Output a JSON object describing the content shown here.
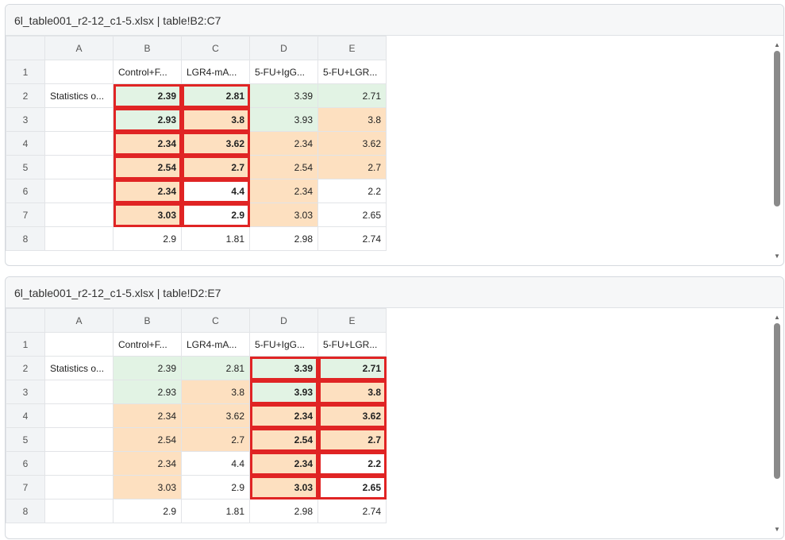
{
  "panels": [
    {
      "title": "6l_table001_r2-12_c1-5.xlsx | table!B2:C7",
      "columns": [
        "A",
        "B",
        "C",
        "D",
        "E"
      ],
      "rows": [
        {
          "num": "1",
          "cells": [
            "",
            "Control+F...",
            "LGR4-mA...",
            "5-FU+IgG...",
            "5-FU+LGR..."
          ]
        },
        {
          "num": "2",
          "cells": [
            "Statistics o...",
            "2.39",
            "2.81",
            "3.39",
            "2.71"
          ]
        },
        {
          "num": "3",
          "cells": [
            "",
            "2.93",
            "3.8",
            "3.93",
            "3.8"
          ]
        },
        {
          "num": "4",
          "cells": [
            "",
            "2.34",
            "3.62",
            "2.34",
            "3.62"
          ]
        },
        {
          "num": "5",
          "cells": [
            "",
            "2.54",
            "2.7",
            "2.54",
            "2.7"
          ]
        },
        {
          "num": "6",
          "cells": [
            "",
            "2.34",
            "4.4",
            "2.34",
            "2.2"
          ]
        },
        {
          "num": "7",
          "cells": [
            "",
            "3.03",
            "2.9",
            "3.03",
            "2.65"
          ]
        },
        {
          "num": "8",
          "cells": [
            "",
            "2.9",
            "1.81",
            "2.98",
            "2.74"
          ]
        }
      ]
    },
    {
      "title": "6l_table001_r2-12_c1-5.xlsx | table!D2:E7",
      "columns": [
        "A",
        "B",
        "C",
        "D",
        "E"
      ],
      "rows": [
        {
          "num": "1",
          "cells": [
            "",
            "Control+F...",
            "LGR4-mA...",
            "5-FU+IgG...",
            "5-FU+LGR..."
          ]
        },
        {
          "num": "2",
          "cells": [
            "Statistics o...",
            "2.39",
            "2.81",
            "3.39",
            "2.71"
          ]
        },
        {
          "num": "3",
          "cells": [
            "",
            "2.93",
            "3.8",
            "3.93",
            "3.8"
          ]
        },
        {
          "num": "4",
          "cells": [
            "",
            "2.34",
            "3.62",
            "2.34",
            "3.62"
          ]
        },
        {
          "num": "5",
          "cells": [
            "",
            "2.54",
            "2.7",
            "2.54",
            "2.7"
          ]
        },
        {
          "num": "6",
          "cells": [
            "",
            "2.34",
            "4.4",
            "2.34",
            "2.2"
          ]
        },
        {
          "num": "7",
          "cells": [
            "",
            "3.03",
            "2.9",
            "3.03",
            "2.65"
          ]
        },
        {
          "num": "8",
          "cells": [
            "",
            "2.9",
            "1.81",
            "2.98",
            "2.74"
          ]
        }
      ]
    }
  ],
  "colors": {
    "green_fill": "#e2f3e4",
    "orange_fill": "#fde0c0",
    "selection": "#e02424"
  }
}
